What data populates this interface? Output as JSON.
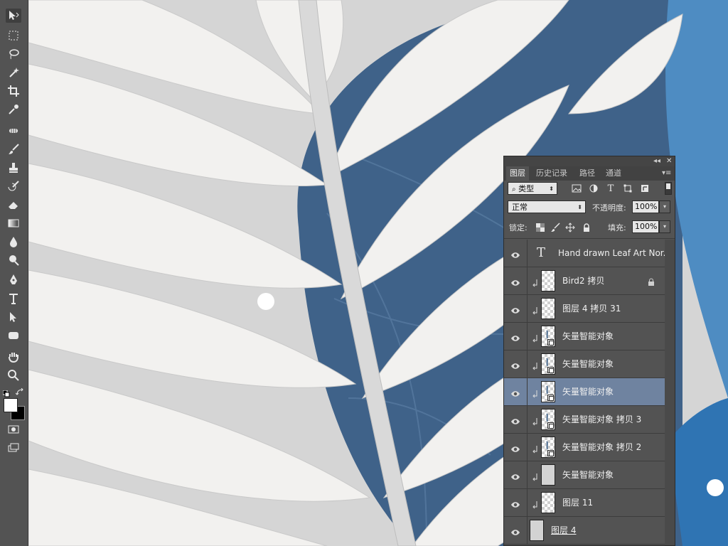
{
  "panel": {
    "tabs": [
      "图层",
      "历史记录",
      "路径",
      "通道"
    ],
    "filter_kind": "类型",
    "blend_mode": "正常",
    "opacity_label": "不透明度:",
    "opacity_value": "100%",
    "lock_label": "锁定:",
    "fill_label": "填充:",
    "fill_value": "100%"
  },
  "layers": [
    {
      "name": "Hand drawn Leaf Art Nor...",
      "kind": "text",
      "visible": true,
      "clipped": false,
      "selected": false,
      "locked": false
    },
    {
      "name": "Bird2 拷贝",
      "kind": "raster",
      "visible": true,
      "clipped": true,
      "selected": false,
      "locked": true
    },
    {
      "name": "图层 4 拷贝 31",
      "kind": "raster",
      "visible": true,
      "clipped": true,
      "selected": false,
      "locked": false
    },
    {
      "name": "矢量智能对象",
      "kind": "smart",
      "visible": true,
      "clipped": true,
      "selected": false,
      "locked": false
    },
    {
      "name": "矢量智能对象",
      "kind": "smart",
      "visible": true,
      "clipped": true,
      "selected": false,
      "locked": false
    },
    {
      "name": "矢量智能对象",
      "kind": "smart",
      "visible": true,
      "clipped": true,
      "selected": true,
      "locked": false
    },
    {
      "name": "矢量智能对象 拷贝 3",
      "kind": "smart",
      "visible": true,
      "clipped": true,
      "selected": false,
      "locked": false
    },
    {
      "name": "矢量智能对象 拷贝 2",
      "kind": "smart",
      "visible": true,
      "clipped": true,
      "selected": false,
      "locked": false
    },
    {
      "name": "矢量智能对象",
      "kind": "gray",
      "visible": true,
      "clipped": true,
      "selected": false,
      "locked": false
    },
    {
      "name": "图层 11",
      "kind": "raster",
      "visible": true,
      "clipped": true,
      "selected": false,
      "locked": false
    },
    {
      "name": "图层 4",
      "kind": "gray",
      "visible": true,
      "clipped": false,
      "selected": false,
      "locked": false
    }
  ],
  "tools": [
    "move-tool",
    "marquee-tool",
    "lasso-tool",
    "magic-wand-tool",
    "crop-tool",
    "eyedropper-tool",
    "healing-tool",
    "brush-tool",
    "stamp-tool",
    "history-brush-tool",
    "eraser-tool",
    "gradient-tool",
    "blur-tool",
    "dodge-tool",
    "pen-tool",
    "type-tool",
    "path-select-tool",
    "shape-tool",
    "hand-tool",
    "zoom-tool"
  ],
  "colors": {
    "foreground": "#ffffff",
    "background": "#000000",
    "selected_layer": "#6f83a0",
    "panel_bg": "#535353"
  }
}
